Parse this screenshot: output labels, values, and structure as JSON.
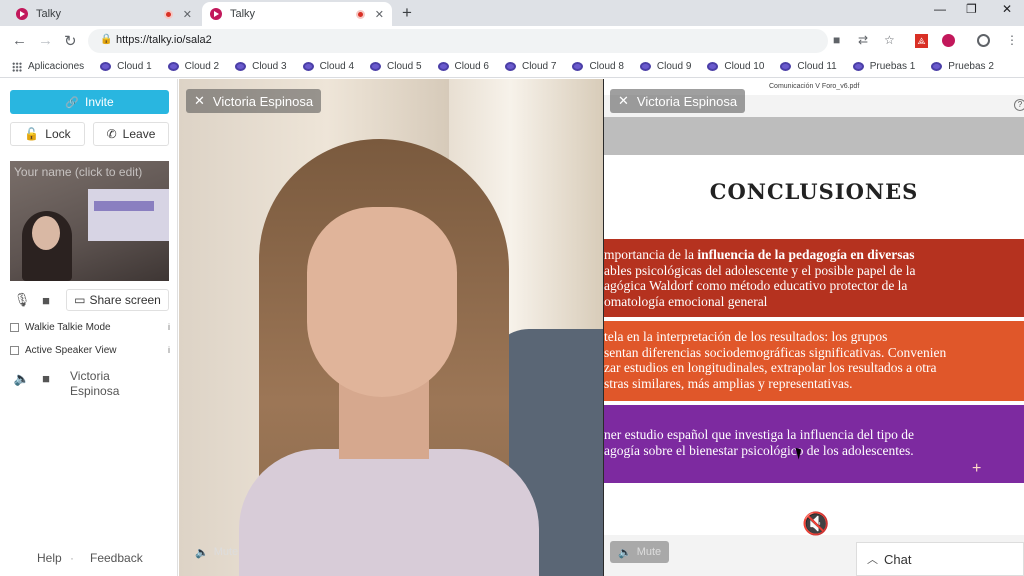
{
  "browser": {
    "tabs": [
      {
        "title": "Talky"
      },
      {
        "title": "Talky"
      }
    ],
    "url": "https://talky.io/sala2",
    "bookmarks": [
      "Aplicaciones",
      "Cloud 1",
      "Cloud 2",
      "Cloud 3",
      "Cloud 4",
      "Cloud 5",
      "Cloud 6",
      "Cloud 7",
      "Cloud 8",
      "Cloud 9",
      "Cloud 10",
      "Cloud 11",
      "Pruebas 1",
      "Pruebas 2"
    ]
  },
  "sidebar": {
    "invite_label": "Invite",
    "lock_label": "Lock",
    "leave_label": "Leave",
    "name_placeholder": "Your name (click to edit)",
    "share_label": "Share screen",
    "walkie_label": "Walkie Talkie Mode",
    "active_speaker_label": "Active Speaker View",
    "peer_name": "Victoria Espinosa",
    "help_label": "Help",
    "feedback_label": "Feedback"
  },
  "tiles": {
    "left_name": "Victoria Espinosa",
    "right_name": "Victoria Espinosa",
    "mute_label": "Mute",
    "chat_label": "Chat"
  },
  "slide": {
    "pdf_tab": "Comunicación V Foro_v6.pdf",
    "title": "CONCLUSIONES",
    "band1": [
      {
        "text": "mportancia de la ",
        "bold": false
      },
      {
        "text": "influencia de la pedagogía en diversas",
        "bold": true
      }
    ],
    "band1_lines": [
      "ables psicológicas del adolescente y el posible papel de la",
      "agógica Waldorf como método educativo protector de la",
      "omatología emocional general"
    ],
    "band2_lines": [
      "tela en la interpretación de los resultados: los grupos",
      "sentan diferencias sociodemográficas significativas. Convenien",
      "zar estudios en longitudinales, extrapolar los resultados a otra",
      "stras similares, más amplias y representativas."
    ],
    "band3_lines": [
      "ner estudio español que investiga la influencia del tipo de",
      "agogía sobre el bienestar psicológico de los adolescentes."
    ]
  }
}
